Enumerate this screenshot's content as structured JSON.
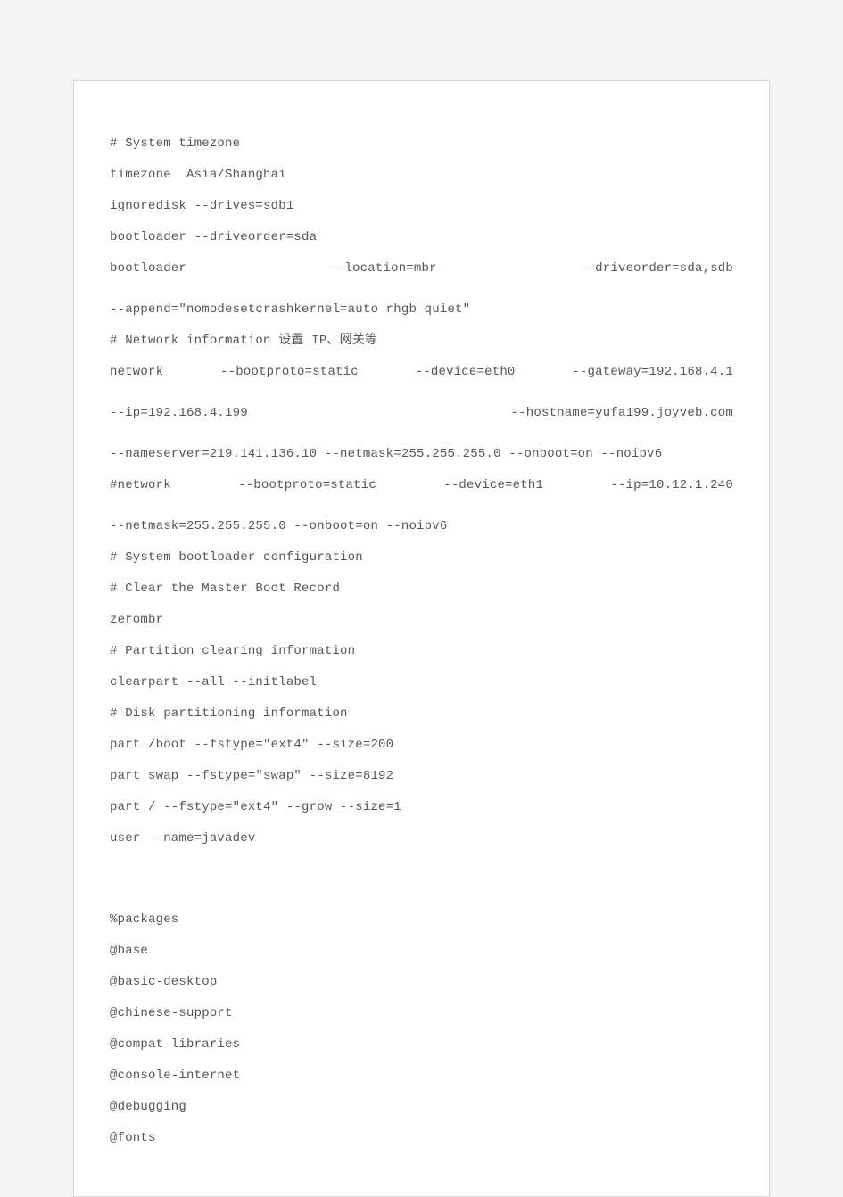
{
  "lines": [
    "# System timezone",
    "timezone  Asia/Shanghai",
    "ignoredisk --drives=sdb1",
    "bootloader --driveorder=sda",
    "bootloader --location=mbr --driveorder=sda,sdb --append=\"nomodesetcrashkernel=auto rhgb quiet\"",
    "# Network information 设置 IP、网关等",
    "network --bootproto=static --device=eth0 --gateway=192.168.4.1 --ip=192.168.4.199 --hostname=yufa199.joyveb.com --nameserver=219.141.136.10 --netmask=255.255.255.0 --onboot=on --noipv6",
    "#network --bootproto=static --device=eth1 --ip=10.12.1.240 --netmask=255.255.255.0 --onboot=on --noipv6",
    "# System bootloader configuration",
    "# Clear the Master Boot Record",
    "zerombr",
    "# Partition clearing information",
    "clearpart --all --initlabel",
    "# Disk partitioning information",
    "part /boot --fstype=\"ext4\" --size=200",
    "part swap --fstype=\"swap\" --size=8192",
    "part / --fstype=\"ext4\" --grow --size=1",
    "user --name=javadev",
    "",
    "",
    "%packages",
    "@base",
    "@basic-desktop",
    "@chinese-support",
    "@compat-libraries",
    "@console-internet",
    "@debugging",
    "@fonts"
  ],
  "render": [
    {
      "t": "line",
      "i": 0
    },
    {
      "t": "line",
      "i": 1
    },
    {
      "t": "line",
      "i": 2
    },
    {
      "t": "line",
      "i": 3
    },
    {
      "t": "justify",
      "parts": [
        "bootloader",
        "--location=mbr",
        "--driveorder=sda,sdb"
      ]
    },
    {
      "t": "cont",
      "text": "--append=\"nomodesetcrashkernel=auto rhgb quiet\""
    },
    {
      "t": "line",
      "i": 5
    },
    {
      "t": "justify",
      "parts": [
        "network",
        "--bootproto=static",
        "--device=eth0",
        "--gateway=192.168.4.1"
      ]
    },
    {
      "t": "justify",
      "parts": [
        "--ip=192.168.4.199",
        "--hostname=yufa199.joyveb.com"
      ],
      "cont": true
    },
    {
      "t": "cont",
      "text": "--nameserver=219.141.136.10 --netmask=255.255.255.0 --onboot=on --noipv6"
    },
    {
      "t": "justify",
      "parts": [
        "#network",
        "--bootproto=static",
        "--device=eth1",
        "--ip=10.12.1.240"
      ]
    },
    {
      "t": "cont",
      "text": "--netmask=255.255.255.0 --onboot=on --noipv6"
    },
    {
      "t": "line",
      "i": 8
    },
    {
      "t": "line",
      "i": 9
    },
    {
      "t": "line",
      "i": 10
    },
    {
      "t": "line",
      "i": 11
    },
    {
      "t": "line",
      "i": 12
    },
    {
      "t": "line",
      "i": 13
    },
    {
      "t": "line",
      "i": 14
    },
    {
      "t": "line",
      "i": 15
    },
    {
      "t": "line",
      "i": 16
    },
    {
      "t": "line",
      "i": 17
    },
    {
      "t": "blank"
    },
    {
      "t": "blank"
    },
    {
      "t": "line",
      "i": 20
    },
    {
      "t": "line",
      "i": 21
    },
    {
      "t": "line",
      "i": 22
    },
    {
      "t": "line",
      "i": 23
    },
    {
      "t": "line",
      "i": 24
    },
    {
      "t": "line",
      "i": 25
    },
    {
      "t": "line",
      "i": 26
    },
    {
      "t": "line",
      "i": 27
    }
  ]
}
